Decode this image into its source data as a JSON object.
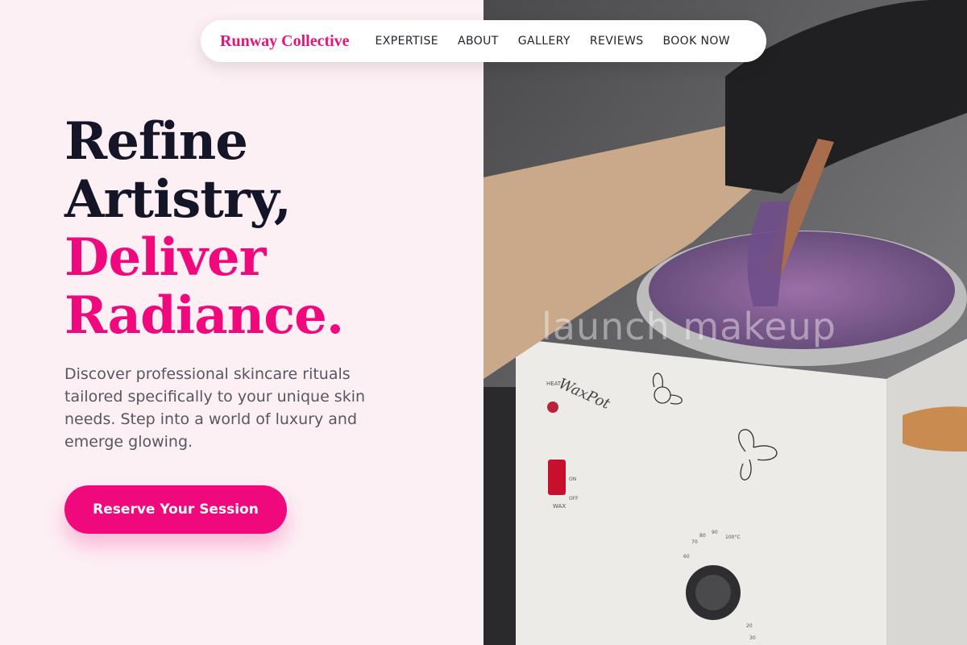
{
  "nav": {
    "brand": "Runway Collective",
    "links": [
      "EXPERTISE",
      "ABOUT",
      "GALLERY",
      "REVIEWS",
      "BOOK NOW"
    ]
  },
  "hero": {
    "line1": "Refine",
    "line2": "Artistry,",
    "line3": "Deliver",
    "line4": "Radiance.",
    "description": "Discover professional skincare rituals tailored specifically to your unique skin needs. Step into a world of luxury and emerge glowing.",
    "cta_label": "Reserve Your Session"
  },
  "image": {
    "watermark": "launch makeup",
    "subject": "gloved hand stirring purple wax in a white wax warmer",
    "device_labels": {
      "brand": "WaxPot",
      "heat": "HEAT",
      "on": "ON",
      "off": "OFF",
      "wax": "WAX",
      "dial_1": "60",
      "dial_2": "70",
      "dial_3": "80",
      "dial_4": "90",
      "dial_5": "100°C",
      "dial_6": "20",
      "dial_7": "30"
    }
  },
  "colors": {
    "accent": "#f0097c",
    "heading_dark": "#141628",
    "background": "#fdf0f5",
    "text_body": "#56575f"
  }
}
